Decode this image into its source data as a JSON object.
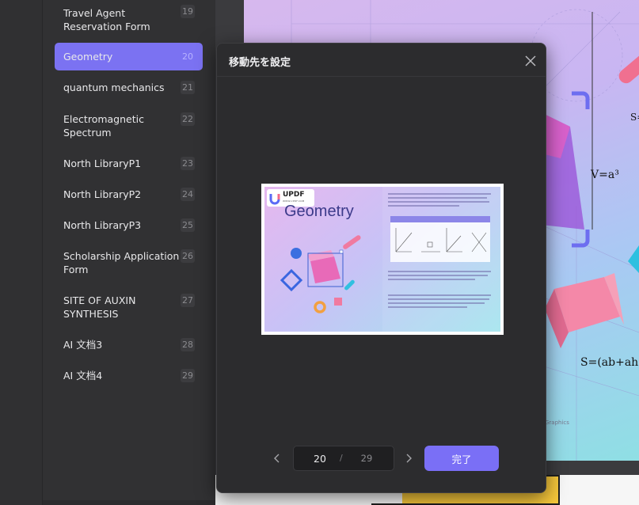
{
  "outline": {
    "items": [
      {
        "label": "Travel Agent Reservation Form",
        "page": "19"
      },
      {
        "label": "Geometry",
        "page": "20"
      },
      {
        "label": "quantum mechanics",
        "page": "21"
      },
      {
        "label": "Electromagnetic Spectrum",
        "page": "22"
      },
      {
        "label": "North LibraryP1",
        "page": "23"
      },
      {
        "label": "North LibraryP2",
        "page": "24"
      },
      {
        "label": "North LibraryP3",
        "page": "25"
      },
      {
        "label": "Scholarship Application Form",
        "page": "26"
      },
      {
        "label": "SITE OF AUXIN SYNTHESIS",
        "page": "27"
      },
      {
        "label": "AI 文档3",
        "page": "28"
      },
      {
        "label": "AI 文档4",
        "page": "29"
      }
    ],
    "active_index": 1
  },
  "document": {
    "formulas": [
      "V=a³",
      "S=(ab+ah+bh",
      "S="
    ],
    "footer_text": "Graphics"
  },
  "modal": {
    "title": "移動先を設定",
    "preview": {
      "brand": "UPDF",
      "brand_sub": "WWW.UPDF.COM",
      "title": "Geometry"
    },
    "pager": {
      "current": "20",
      "separator": "/",
      "total": "29"
    },
    "done_label": "完了"
  },
  "colors": {
    "accent": "#7a6ff6",
    "active_item": "#7b72f2",
    "panel": "#313133",
    "modal": "#2c2c2e"
  },
  "icons": {
    "close": "close-icon",
    "prev": "chevron-left-icon",
    "next": "chevron-right-icon"
  }
}
